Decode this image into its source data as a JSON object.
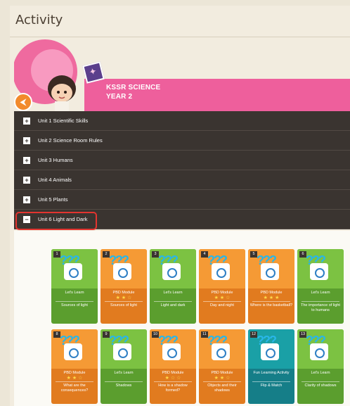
{
  "page_title": "Activity",
  "course": {
    "line1": "KSSR SCIENCE",
    "line2": "YEAR 2"
  },
  "units": [
    {
      "label": "Unit 1 Scientific Skills",
      "icon": "+"
    },
    {
      "label": "Unit 2 Science Room Rules",
      "icon": "+"
    },
    {
      "label": "Unit 3 Humans",
      "icon": "+"
    },
    {
      "label": "Unit 4 Animals",
      "icon": "+"
    },
    {
      "label": "Unit 5 Plants",
      "icon": "+"
    },
    {
      "label": "Unit 6 Light and Dark",
      "icon": "−"
    }
  ],
  "activities": [
    {
      "num": "1",
      "type": "Let's Learn",
      "stars": "",
      "label": "Sources of light",
      "color": "green"
    },
    {
      "num": "2",
      "type": "PBD Module",
      "stars": "★ ★ ☆",
      "label": "Sources of light",
      "color": "orange"
    },
    {
      "num": "3",
      "type": "Let's Learn",
      "stars": "",
      "label": "Light and dark",
      "color": "green"
    },
    {
      "num": "4",
      "type": "PBD Module",
      "stars": "★ ★ ☆",
      "label": "Day and night",
      "color": "orange"
    },
    {
      "num": "5",
      "type": "PBD Module",
      "stars": "★ ★ ★",
      "label": "Where is the basketball?",
      "color": "orange"
    },
    {
      "num": "6",
      "type": "Let's Learn",
      "stars": "",
      "label": "The importance of light to humans",
      "color": "green"
    },
    {
      "num": "8",
      "type": "PBD Module",
      "stars": "★ ★ ☆",
      "label": "What are the consequences?",
      "color": "orange"
    },
    {
      "num": "9",
      "type": "Let's Learn",
      "stars": "",
      "label": "Shadows",
      "color": "green"
    },
    {
      "num": "10",
      "type": "PBD Module",
      "stars": "★ ☆ ☆",
      "label": "How is a shadow formed?",
      "color": "orange"
    },
    {
      "num": "11",
      "type": "PBD Module",
      "stars": "★ ★ ☆",
      "label": "Objects and their shadows",
      "color": "orange"
    },
    {
      "num": "12",
      "type": "Fun Learning Activity",
      "stars": "",
      "label": "Flip & Match",
      "color": "teal"
    },
    {
      "num": "13",
      "type": "Let's Learn",
      "stars": "",
      "label": "Clarity of shadows",
      "color": "green"
    }
  ]
}
